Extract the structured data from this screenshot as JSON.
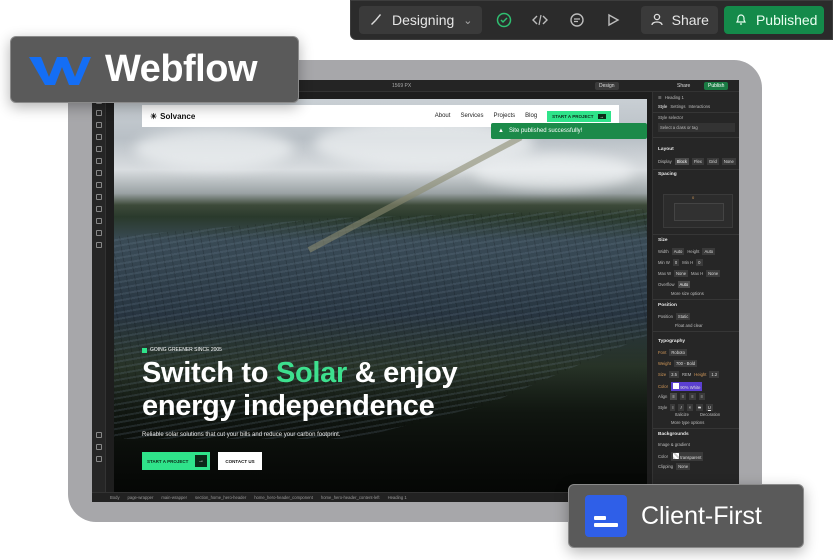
{
  "toolbar": {
    "mode_label": "Designing",
    "share_label": "Share",
    "publish_label": "Published"
  },
  "badges": {
    "webflow": "Webflow",
    "clientfirst": "Client-First"
  },
  "editor": {
    "width_readout": "1569 PX",
    "design_label": "Design",
    "share_label": "Share",
    "publish_label": "Publish",
    "toast": "Site published successfully!",
    "breadcrumbs": [
      "Body",
      "page-wrapper",
      "main-wrapper",
      "section_home_hero-header",
      "home_hero-header_component",
      "home_hero-header_content-left",
      "Heading 1"
    ]
  },
  "site": {
    "brand": "Solvance",
    "nav": [
      "About",
      "Services",
      "Projects",
      "Blog"
    ],
    "nav_cta": "START A PROJECT",
    "eyebrow": "GOING GREENER SINCE 2005",
    "headline_pre": "Switch to ",
    "headline_accent": "Solar",
    "headline_post": " & enjoy energy independence",
    "subtext": "Reliable solar solutions that cut your bills and reduce your carbon footprint.",
    "cta_primary": "START A PROJECT",
    "cta_secondary": "CONTACT US",
    "accent_color": "#2fe38a"
  },
  "panel": {
    "element": "Heading 1",
    "tabs": [
      "Style",
      "Settings",
      "Interactions"
    ],
    "style_selector": "Style selector",
    "class_placeholder": "Select a class or tag",
    "layout": "Layout",
    "display_label": "Display",
    "display_options": [
      "Block",
      "Flex",
      "Grid",
      "None"
    ],
    "spacing": "Spacing",
    "size": "Size",
    "width": "Width",
    "height": "Height",
    "minw": "Min W",
    "minh": "Min H",
    "maxw": "Max W",
    "maxh": "Max H",
    "auto": "Auto",
    "none": "None",
    "zero": "0",
    "px": "PX",
    "overflow": "Overflow",
    "more_size": "More size options",
    "position": "Position",
    "position_label": "Position",
    "position_value": "Static",
    "float_clear": "Float and clear",
    "typography": "Typography",
    "font_label": "Font",
    "font_value": "Roboto",
    "weight_label": "Weight",
    "weight_value": "700 - Bold",
    "size_label": "Size",
    "size_value": "3.5",
    "size_unit": "REM",
    "lh_label": "Height",
    "lh_value": "1.2",
    "color_label": "Color",
    "color_value": "90% White",
    "align_label": "Align",
    "style_label": "Style",
    "italicize": "Italicize",
    "decoration": "Decoration",
    "more_type": "More type options",
    "backgrounds": "Backgrounds",
    "image_gradient": "Image & gradient",
    "bg_color_label": "Color",
    "bg_color_value": "transparent",
    "clipping_label": "Clipping",
    "clipping_value": "None"
  }
}
